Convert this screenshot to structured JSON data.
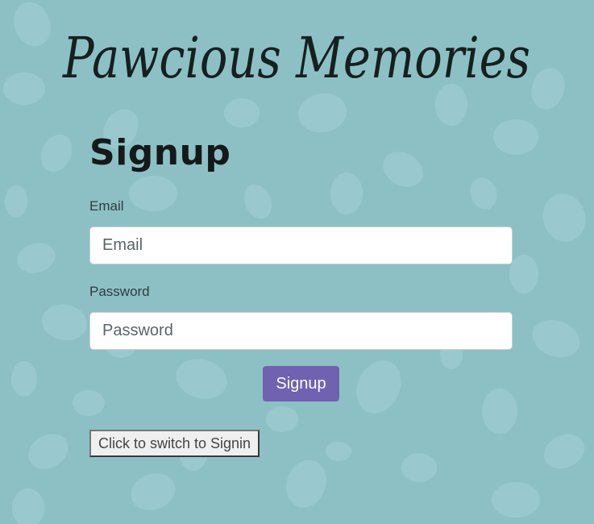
{
  "app": {
    "title": "Pawcious Memories"
  },
  "form": {
    "heading": "Signup",
    "email_label": "Email",
    "email_placeholder": "Email",
    "email_value": "",
    "password_label": "Password",
    "password_placeholder": "Password",
    "password_value": "",
    "submit_label": "Signup"
  },
  "switch_label": "Click to switch to Signin",
  "colors": {
    "background": "#8dc0c5",
    "pawprint": "#9ecdd1",
    "submit_button": "#7061b1",
    "heading_text": "#15191a"
  }
}
